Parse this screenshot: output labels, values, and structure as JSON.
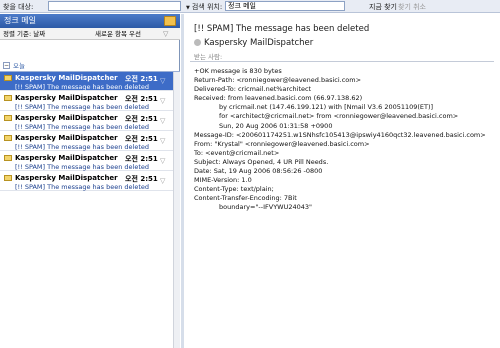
{
  "search": {
    "label": "찾을 대상:",
    "input_value": "",
    "scope_label": "검색 위치:",
    "scope_value": "정크 메일",
    "find_now": "지금 찾기",
    "clear": "찾기 취소"
  },
  "folder": {
    "name": "정크 메일",
    "arrange_by": "정렬 기준: 날짜",
    "order": "새로운 항목 우선",
    "group": "오늘"
  },
  "messages": [
    {
      "sender": "Kaspersky MailDispatcher",
      "time": "오전 2:51",
      "subject": "[!! SPAM] The message has been deleted"
    },
    {
      "sender": "Kaspersky MailDispatcher",
      "time": "오전 2:51",
      "subject": "[!! SPAM] The message has been deleted"
    },
    {
      "sender": "Kaspersky MailDispatcher",
      "time": "오전 2:51",
      "subject": "[!! SPAM] The message has been deleted"
    },
    {
      "sender": "Kaspersky MailDispatcher",
      "time": "오전 2:51",
      "subject": "[!! SPAM] The message has been deleted"
    },
    {
      "sender": "Kaspersky MailDispatcher",
      "time": "오전 2:51",
      "subject": "[!! SPAM] The message has been deleted"
    },
    {
      "sender": "Kaspersky MailDispatcher",
      "time": "오전 2:51",
      "subject": "[!! SPAM] The message has been deleted"
    }
  ],
  "reading": {
    "subject": "[!! SPAM] The message has been deleted",
    "from": "Kaspersky MailDispatcher",
    "to_label": "받는 사람:",
    "body": [
      "+OK message is 830 bytes",
      "Return-Path: <ronniegower@leavened.basici.com>",
      "Delivered-To: cricmail.net%architect",
      "Received: from leavened.basici.com (66.97.138.62)",
      "by cricmail.net (147.46.199.121) with [Nmail V3.6 20051109(ET)]",
      "for <architect@cricmail.net> from <ronniegower@leavened.basici.com>",
      "Sun, 20 Aug 2006 01:31:58 +0900",
      "Message-ID: <200601174251.w1SNhsfc105413@ipswiy4160qct32.leavened.basici.com>",
      "From: \"Krystal\" <ronniegower@leavened.basici.com>",
      "To: <event@cricmail.net>",
      "Subject: Always Opened, 4 UR Pill Needs.",
      "Date: Sat, 19 Aug 2006 08:56:26 -0800",
      "MIME-Version: 1.0",
      "Content-Type: text/plain;",
      "Content-Transfer-Encoding: 7Bit",
      "boundary=\"--IFVYWU24043\""
    ]
  }
}
